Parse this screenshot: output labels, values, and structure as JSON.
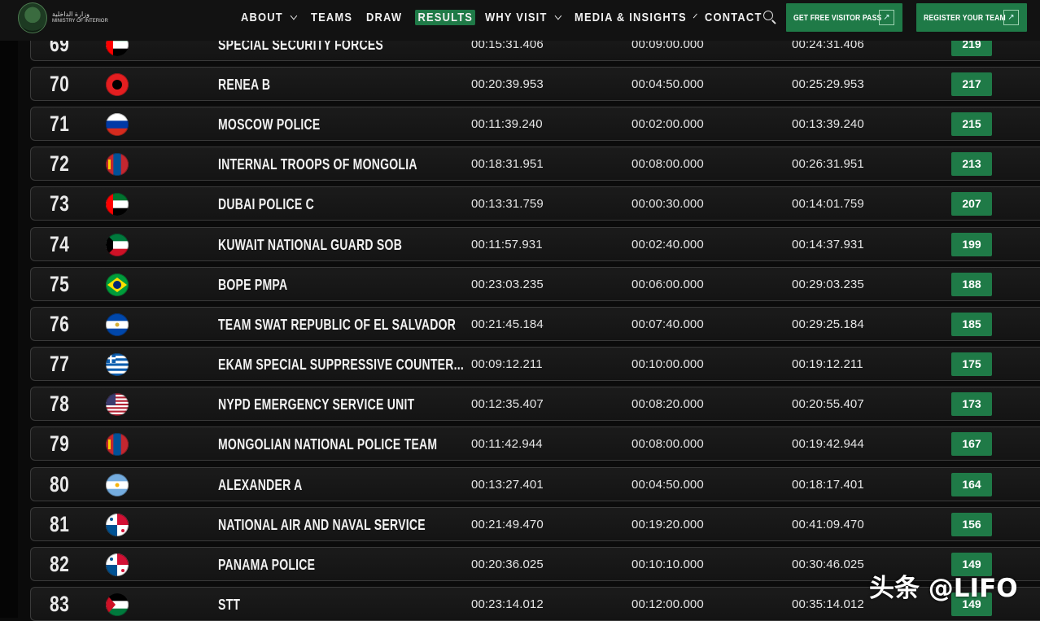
{
  "header": {
    "logo_text_ar": "وزارة الداخلية",
    "logo_text_en": "MINISTRY OF INTERIOR",
    "menu": [
      {
        "label": "ABOUT",
        "has_dropdown": true
      },
      {
        "label": "TEAMS",
        "has_dropdown": false
      },
      {
        "label": "DRAW",
        "has_dropdown": false
      },
      {
        "label": "RESULTS",
        "has_dropdown": false,
        "active": true
      },
      {
        "label": "WHY VISIT",
        "has_dropdown": true
      },
      {
        "label": "MEDIA & INSIGHTS",
        "has_dropdown": true
      },
      {
        "label": "CONTACT",
        "has_dropdown": false
      }
    ],
    "search_icon": "search-icon",
    "cta_visitor": "GET FREE VISITOR PASS",
    "cta_register": "REGISTER YOUR TEAM",
    "accent_color": "#1f7a47"
  },
  "results": [
    {
      "rank": "69",
      "flag": "uae",
      "team": "SPECIAL SECURITY FORCES",
      "time1": "00:15:31.406",
      "time2": "00:09:00.000",
      "time3": "00:24:31.406",
      "score": "219"
    },
    {
      "rank": "70",
      "flag": "albania",
      "team": "RENEA B",
      "time1": "00:20:39.953",
      "time2": "00:04:50.000",
      "time3": "00:25:29.953",
      "score": "217"
    },
    {
      "rank": "71",
      "flag": "russia",
      "team": "MOSCOW POLICE",
      "time1": "00:11:39.240",
      "time2": "00:02:00.000",
      "time3": "00:13:39.240",
      "score": "215"
    },
    {
      "rank": "72",
      "flag": "mongolia",
      "team": "INTERNAL TROOPS OF MONGOLIA",
      "time1": "00:18:31.951",
      "time2": "00:08:00.000",
      "time3": "00:26:31.951",
      "score": "213"
    },
    {
      "rank": "73",
      "flag": "uae",
      "team": "DUBAI POLICE C",
      "time1": "00:13:31.759",
      "time2": "00:00:30.000",
      "time3": "00:14:01.759",
      "score": "207"
    },
    {
      "rank": "74",
      "flag": "kuwait",
      "team": "KUWAIT NATIONAL GUARD SOB",
      "time1": "00:11:57.931",
      "time2": "00:02:40.000",
      "time3": "00:14:37.931",
      "score": "199"
    },
    {
      "rank": "75",
      "flag": "brazil",
      "team": "BOPE PMPA",
      "time1": "00:23:03.235",
      "time2": "00:06:00.000",
      "time3": "00:29:03.235",
      "score": "188"
    },
    {
      "rank": "76",
      "flag": "el-salvador",
      "team": "TEAM SWAT REPUBLIC OF EL SALVADOR",
      "time1": "00:21:45.184",
      "time2": "00:07:40.000",
      "time3": "00:29:25.184",
      "score": "185"
    },
    {
      "rank": "77",
      "flag": "greece",
      "team": "EKAM SPECIAL SUPPRESSIVE COUNTER...",
      "time1": "00:09:12.211",
      "time2": "00:10:00.000",
      "time3": "00:19:12.211",
      "score": "175"
    },
    {
      "rank": "78",
      "flag": "usa",
      "team": "NYPD EMERGENCY SERVICE UNIT",
      "time1": "00:12:35.407",
      "time2": "00:08:20.000",
      "time3": "00:20:55.407",
      "score": "173"
    },
    {
      "rank": "79",
      "flag": "mongolia",
      "team": "MONGOLIAN NATIONAL POLICE TEAM",
      "time1": "00:11:42.944",
      "time2": "00:08:00.000",
      "time3": "00:19:42.944",
      "score": "167"
    },
    {
      "rank": "80",
      "flag": "argentina",
      "team": "ALEXANDER A",
      "time1": "00:13:27.401",
      "time2": "00:04:50.000",
      "time3": "00:18:17.401",
      "score": "164"
    },
    {
      "rank": "81",
      "flag": "panama",
      "team": "NATIONAL AIR AND NAVAL SERVICE",
      "time1": "00:21:49.470",
      "time2": "00:19:20.000",
      "time3": "00:41:09.470",
      "score": "156"
    },
    {
      "rank": "82",
      "flag": "panama",
      "team": "PANAMA POLICE",
      "time1": "00:20:36.025",
      "time2": "00:10:10.000",
      "time3": "00:30:46.025",
      "score": "149"
    },
    {
      "rank": "83",
      "flag": "palestine",
      "team": "STT",
      "time1": "00:23:14.012",
      "time2": "00:12:00.000",
      "time3": "00:35:14.012",
      "score": "149"
    }
  ],
  "watermark": "头条 @LIFO"
}
